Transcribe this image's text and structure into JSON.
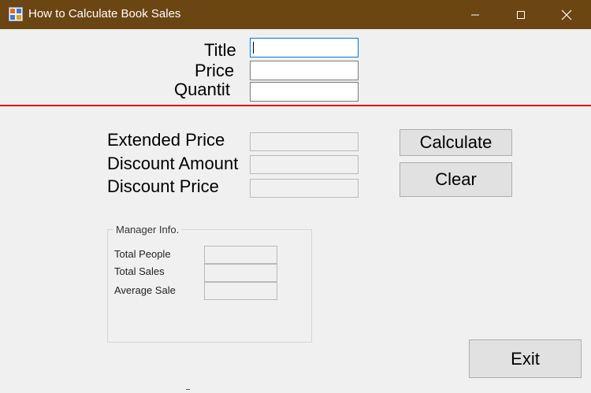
{
  "window": {
    "title": "How to Calculate Book Sales",
    "icon": "app-form-icon",
    "controls": [
      "minimize-icon",
      "maximize-icon",
      "close-icon"
    ]
  },
  "inputs": {
    "title_label": "Title",
    "title_value": "",
    "price_label": "Price",
    "price_value": "",
    "quantity_label": "Quantit",
    "quantity_value": ""
  },
  "results": {
    "extended_price_label": "Extended Price",
    "discount_amount_label": "Discount Amount",
    "discount_price_label": "Discount Price"
  },
  "buttons": {
    "calculate": "Calculate",
    "clear": "Clear",
    "exit": "Exit"
  },
  "manager": {
    "group_label": "Manager Info.",
    "total_people_label": "Total People",
    "total_sales_label": "Total Sales",
    "average_sale_label": "Average Sale"
  },
  "colors": {
    "titlebar": "#6b4512",
    "divider": "#e01010",
    "focus_border": "#0078d7"
  }
}
